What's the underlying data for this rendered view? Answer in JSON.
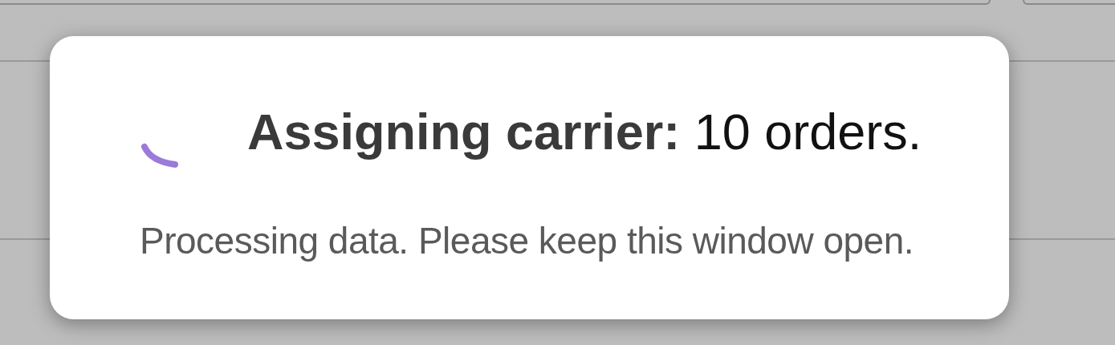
{
  "dialog": {
    "title": {
      "label": "Assigning carrier:",
      "value": "10 orders."
    },
    "message": "Processing data. Please keep this window open."
  }
}
